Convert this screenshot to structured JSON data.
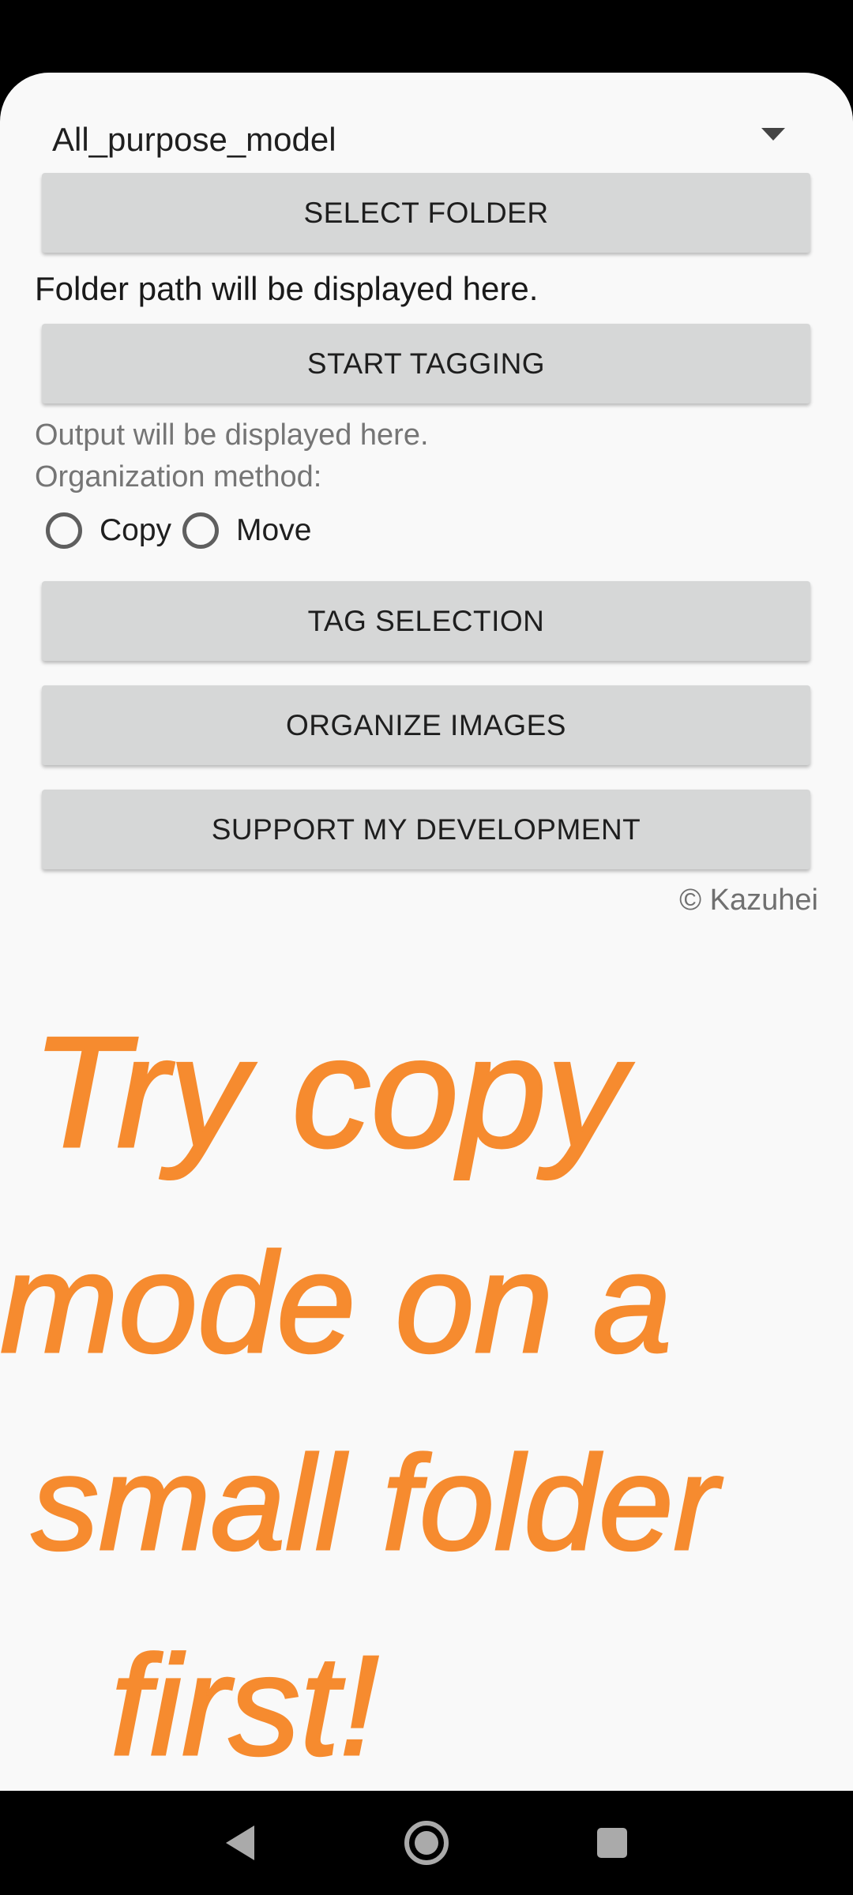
{
  "model_selector": {
    "value": "All_purpose_model"
  },
  "buttons": {
    "select_folder": "SELECT FOLDER",
    "start_tagging": "START TAGGING",
    "tag_selection": "TAG SELECTION",
    "organize_images": "ORGANIZE IMAGES",
    "support": "SUPPORT MY DEVELOPMENT"
  },
  "folder_path_text": "Folder path will be displayed here.",
  "output_text": "Output will be displayed here.",
  "organization": {
    "label": "Organization method:",
    "options": [
      "Copy",
      "Move"
    ]
  },
  "copyright": "© Kazuhei",
  "handwritten_note": {
    "lines": [
      "Try copy",
      "mode on a",
      "small folder",
      "first!"
    ],
    "color": "#f68b2f"
  },
  "navigation": {
    "back": "back-icon",
    "home": "home-icon",
    "recents": "recents-icon"
  }
}
